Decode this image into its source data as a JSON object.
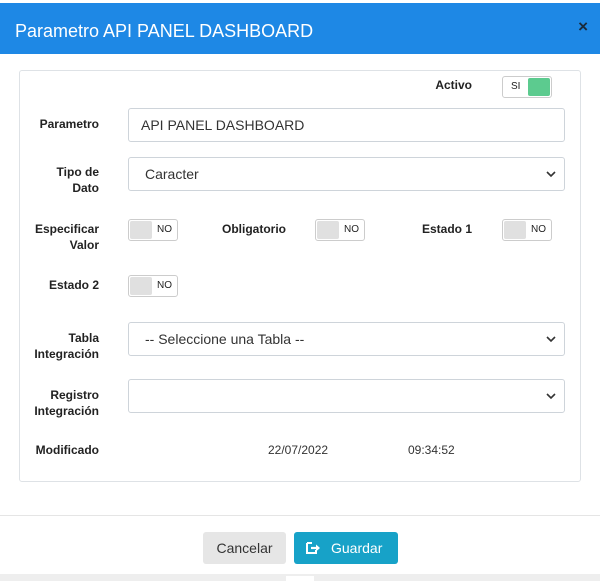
{
  "header": {
    "title": "Parametro API PANEL DASHBOARD",
    "close": "×"
  },
  "form": {
    "activo": {
      "label": "Activo",
      "toggle": "SI"
    },
    "parametro": {
      "label": "Parametro",
      "value": "API PANEL DASHBOARD"
    },
    "tipo_dato": {
      "label_line1": "Tipo de",
      "label_line2": "Dato",
      "value": "Caracter"
    },
    "especificar_valor": {
      "label_line1": "Especificar",
      "label_line2": "Valor",
      "toggle": "NO"
    },
    "obligatorio": {
      "label": "Obligatorio",
      "toggle": "NO"
    },
    "estado1": {
      "label": "Estado 1",
      "toggle": "NO"
    },
    "estado2": {
      "label": "Estado 2",
      "toggle": "NO"
    },
    "tabla_integracion": {
      "label_line1": "Tabla",
      "label_line2": "Integración",
      "value": "-- Seleccione una Tabla --"
    },
    "registro_integracion": {
      "label_line1": "Registro",
      "label_line2": "Integración",
      "value": ""
    },
    "modificado": {
      "label": "Modificado",
      "date": "22/07/2022",
      "time": "09:34:52"
    }
  },
  "footer": {
    "cancel_label": "Cancelar",
    "save_label": "Guardar"
  },
  "colors": {
    "header": "#1e88e5",
    "toggle_on": "#5ccb8f",
    "save_button": "#17a2c8"
  },
  "icons": {
    "close": "close-icon",
    "save": "save-icon",
    "dropdown": "chevron-down-icon"
  }
}
